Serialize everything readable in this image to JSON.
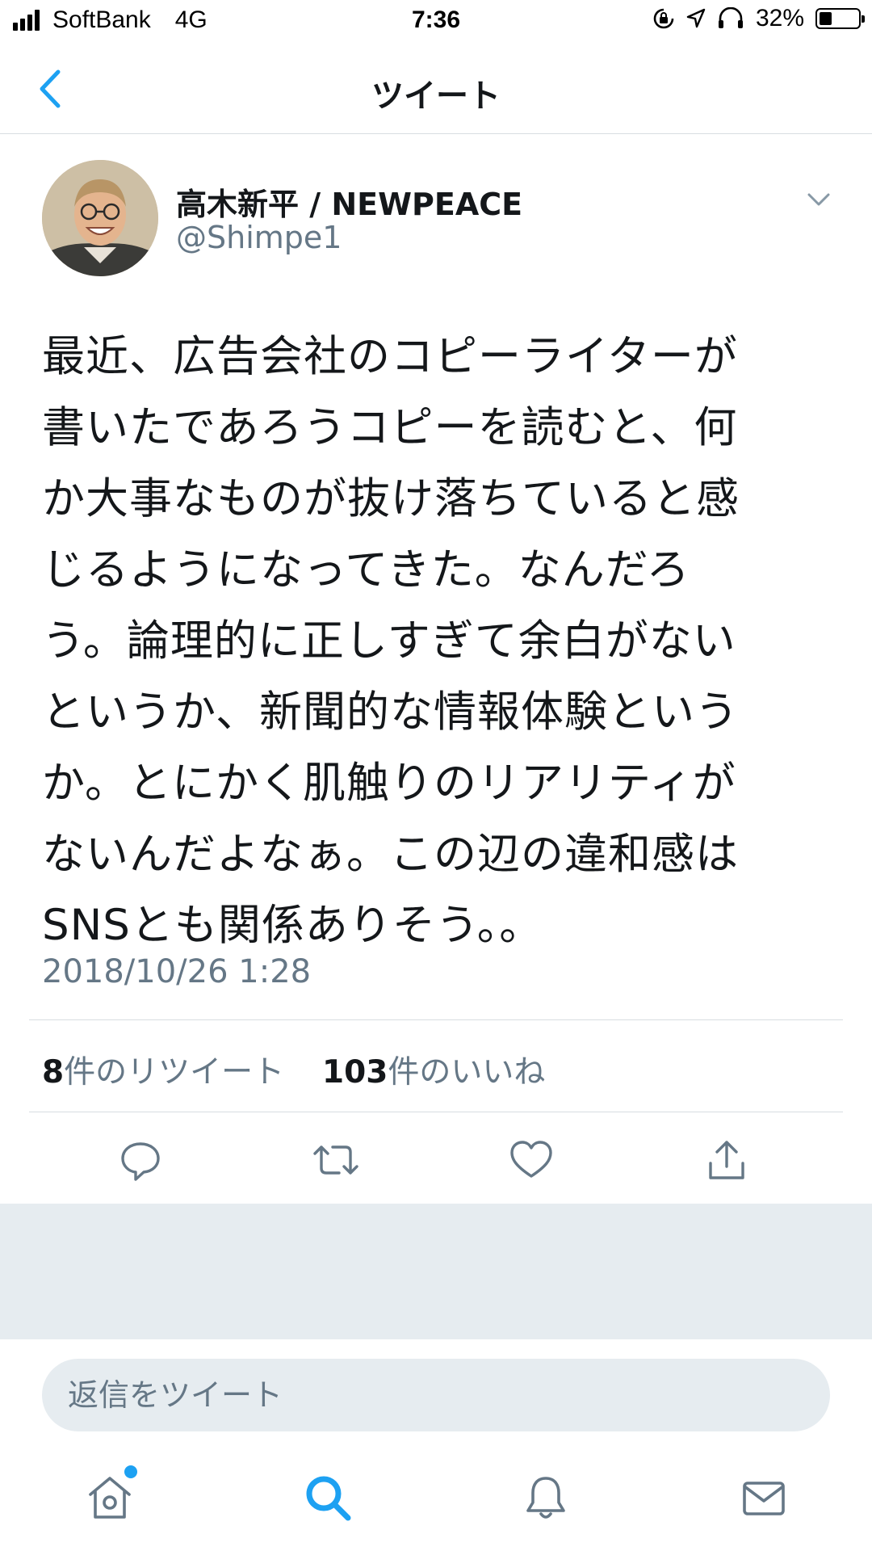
{
  "status_bar": {
    "carrier": "SoftBank",
    "network": "4G",
    "time": "7:36",
    "battery": "32%",
    "battery_level": 0.32
  },
  "header": {
    "title": "ツイート",
    "back_icon": "chevron-left-icon"
  },
  "tweet": {
    "author_name": "高木新平 / NEWPEACE",
    "handle": "@Shimpe1",
    "text": "最近、広告会社のコピーライターが\n書いたであろうコピーを読むと、何\nか大事なものが抜け落ちていると感\nじるようになってきた。なんだろ\nう。論理的に正しすぎて余白がない\nというか、新聞的な情報体験という\nか。とにかく肌触りのリアリティが\nないんだよなぁ。この辺の違和感は\nSNSとも関係ありそう。。",
    "timestamp": "2018/10/26 1:28",
    "retweet_count": "8",
    "retweet_label": "件のリツイート",
    "like_count": "103",
    "like_label": "件のいいね"
  },
  "actions": [
    "reply-icon",
    "retweet-icon",
    "like-icon",
    "share-icon"
  ],
  "reply_bar": {
    "placeholder": "返信をツイート"
  },
  "tab_bar": [
    "home-icon",
    "search-icon",
    "notifications-icon",
    "messages-icon"
  ],
  "colors": {
    "accent": "#1da1f2",
    "secondary_text": "#657786",
    "divider": "#d8dde1",
    "gray_background": "#e6ecf0"
  }
}
